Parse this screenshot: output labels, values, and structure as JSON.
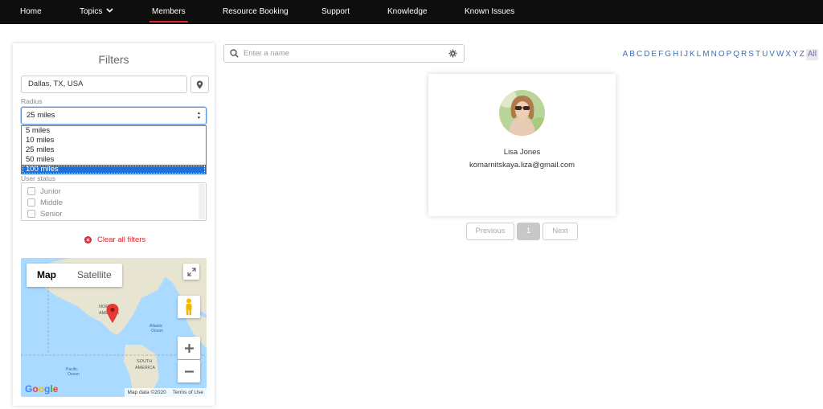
{
  "nav": {
    "items": [
      {
        "label": "Home"
      },
      {
        "label": "Topics"
      },
      {
        "label": "Members"
      },
      {
        "label": "Resource Booking"
      },
      {
        "label": "Support"
      },
      {
        "label": "Knowledge"
      },
      {
        "label": "Known Issues"
      }
    ],
    "active": "Members"
  },
  "filters": {
    "title": "Filters",
    "location_value": "Dallas, TX, USA",
    "radius_label": "Radius",
    "radius_selected": "25 miles",
    "radius_options": [
      "5 miles",
      "10 miles",
      "25 miles",
      "50 miles",
      "100 miles"
    ],
    "highlighted_option": "100 miles",
    "user_status_label": "User status",
    "user_status_options": [
      "Junior",
      "Middle",
      "Senior"
    ],
    "clear_label": "Clear all filters"
  },
  "map": {
    "type_map": "Map",
    "type_satellite": "Satellite",
    "selected_type": "Map",
    "labels": {
      "na": "NORTH AMERICA",
      "atlantic": "Atlantic Ocean",
      "pacific": "Pacific Ocean",
      "sa": "SOUTH AMERICA"
    },
    "logo": "Google",
    "attribution": "Map data ©2020",
    "terms": "Terms of Use"
  },
  "search": {
    "placeholder": "Enter a name"
  },
  "alphabet": [
    "A",
    "B",
    "C",
    "D",
    "E",
    "F",
    "G",
    "H",
    "I",
    "J",
    "K",
    "L",
    "M",
    "N",
    "O",
    "P",
    "Q",
    "R",
    "S",
    "T",
    "U",
    "V",
    "W",
    "X",
    "Y",
    "Z"
  ],
  "alphabet_all": "All",
  "member": {
    "name": "Lisa Jones",
    "email": "komarnitskaya.liza@gmail.com"
  },
  "pagination": {
    "previous": "Previous",
    "current": "1",
    "next": "Next"
  },
  "colors": {
    "nav_bg": "#0e0e0e",
    "accent": "#d9282f",
    "link": "#3c6fc2",
    "highlight": "#1e6fd9"
  }
}
